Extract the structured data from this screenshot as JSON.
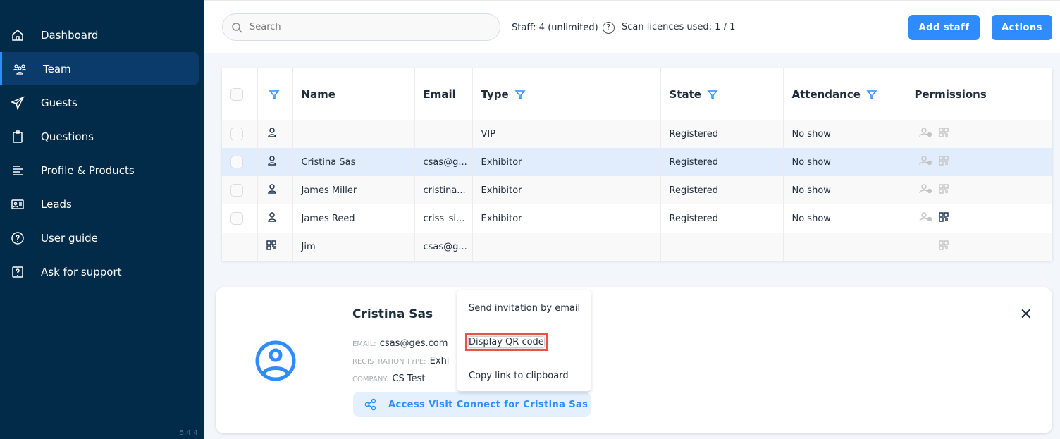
{
  "sidebar": {
    "items": [
      {
        "label": "Dashboard",
        "icon": "home-icon"
      },
      {
        "label": "Team",
        "icon": "team-icon",
        "active": true
      },
      {
        "label": "Guests",
        "icon": "paper-plane-icon"
      },
      {
        "label": "Questions",
        "icon": "clipboard-icon"
      },
      {
        "label": "Profile & Products",
        "icon": "list-icon"
      },
      {
        "label": "Leads",
        "icon": "id-card-icon"
      },
      {
        "label": "User guide",
        "icon": "help-circle-icon"
      },
      {
        "label": "Ask for support",
        "icon": "help-square-icon"
      }
    ],
    "version": "5.4.4"
  },
  "topbar": {
    "search_placeholder": "Search",
    "staff": "Staff: 4 (unlimited)",
    "scan": "Scan licences used: 1 / 1",
    "add_staff": "Add staff",
    "actions": "Actions"
  },
  "table": {
    "headers": [
      "Name",
      "Email",
      "Type",
      "State",
      "Attendance",
      "Permissions"
    ],
    "rows": [
      {
        "name": "",
        "email": "",
        "type": "VIP",
        "state": "Registered",
        "attendance": "No show"
      },
      {
        "name": "Cristina Sas",
        "email": "csas@g...",
        "type": "Exhibitor",
        "state": "Registered",
        "attendance": "No show"
      },
      {
        "name": "James Miller",
        "email": "cristina...",
        "type": "Exhibitor",
        "state": "Registered",
        "attendance": "No show"
      },
      {
        "name": "James Reed",
        "email": "criss_si...",
        "type": "Exhibitor",
        "state": "Registered",
        "attendance": "No show"
      },
      {
        "name": "Jim",
        "email": "csas@g...",
        "type": "",
        "state": "",
        "attendance": ""
      }
    ]
  },
  "detail": {
    "name": "Cristina Sas",
    "email_label": "EMAIL:",
    "email": "csas@ges.com",
    "reg_label": "REGISTRATION TYPE:",
    "reg": "Exhi",
    "company_label": "COMPANY:",
    "company": "CS Test",
    "access": "Access Visit Connect for Cristina Sas"
  },
  "menu": {
    "items": [
      "Send invitation by email",
      "Display QR code",
      "Copy link to clipboard"
    ]
  },
  "colors": {
    "sidebar": "#022b4a",
    "accent": "#2f8cff",
    "highlight": "#e8524a"
  }
}
